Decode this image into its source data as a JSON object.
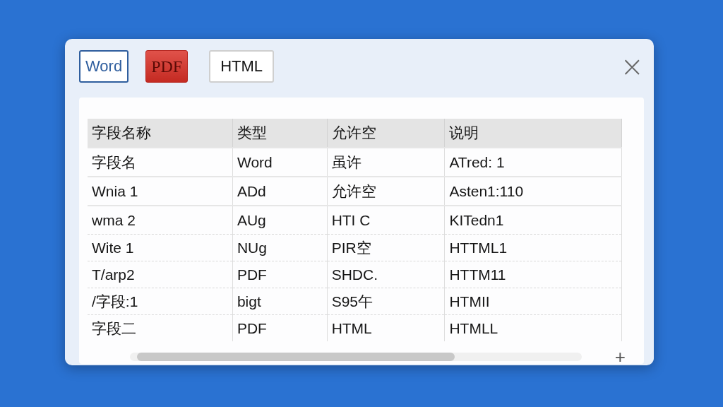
{
  "toolbar": {
    "buttons": [
      {
        "label": "Word",
        "kind": "word"
      },
      {
        "label": "PDF",
        "kind": "pdf"
      },
      {
        "label": "HTML",
        "kind": "html"
      }
    ],
    "close": "×"
  },
  "table": {
    "columns": [
      "字段名称",
      "类型",
      "允许空",
      "说明"
    ],
    "rows": [
      [
        "字段名",
        "Word",
        "虽许",
        "ATred: 1"
      ],
      [
        "Wnia 1",
        "ADd",
        "允许空",
        "Asten1:110"
      ],
      [
        "wma 2",
        "AUg",
        "HTI C",
        "KITedn1"
      ],
      [
        "Wite 1",
        "NUg",
        "PIR空",
        "HTTML1"
      ],
      [
        "T/arp2",
        "PDF",
        "SHDC.",
        "HTTM11"
      ],
      [
        "/字段:1",
        "bigt",
        "S95午",
        "HTMII"
      ],
      [
        "字段二",
        "PDF",
        "HTML",
        "HTMLL"
      ]
    ]
  },
  "scroll": {
    "add": "+"
  }
}
